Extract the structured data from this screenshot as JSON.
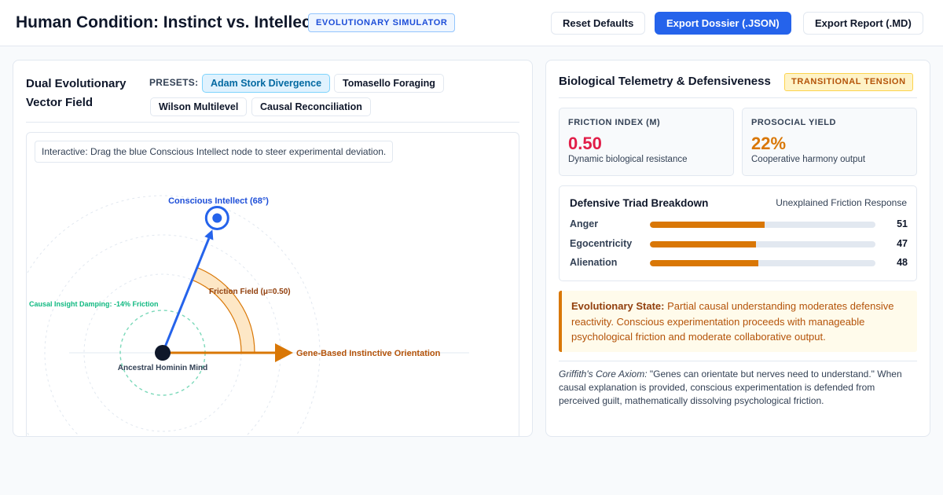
{
  "header": {
    "title": "Human Condition: Instinct vs. Intellect",
    "badge": "EVOLUTIONARY SIMULATOR",
    "buttons": {
      "reset": "Reset Defaults",
      "export_json": "Export Dossier (.JSON)",
      "export_md": "Export Report (.MD)"
    }
  },
  "vector_panel": {
    "title": "Dual Evolutionary Vector Field",
    "presets_label": "PRESETS:",
    "presets": [
      {
        "label": "Adam Stork Divergence",
        "active": true
      },
      {
        "label": "Tomasello Foraging",
        "active": false
      },
      {
        "label": "Wilson Multilevel",
        "active": false
      },
      {
        "label": "Causal Reconciliation",
        "active": false
      }
    ],
    "hint": "Interactive: Drag the blue Conscious Intellect node to steer experimental deviation.",
    "labels": {
      "intellect": "Conscious Intellect (68°)",
      "friction": "Friction Field (μ=0.50)",
      "damping": "Causal Insight Damping: -14% Friction",
      "origin": "Ancestral Hominin Mind",
      "instinct": "Gene-Based Instinctive Orientation"
    },
    "intellect_angle_deg": 68,
    "friction_mu": 0.5,
    "colors": {
      "intellect": "#2563eb",
      "instinct": "#d97706",
      "damping": "#10b981",
      "origin": "#0f172a"
    }
  },
  "telemetry": {
    "title": "Biological Telemetry & Defensiveness",
    "status": "TRANSITIONAL TENSION",
    "metrics": [
      {
        "label": "FRICTION INDEX (M)",
        "value": "0.50",
        "desc": "Dynamic biological resistance",
        "color": "#e11d48"
      },
      {
        "label": "PROSOCIAL YIELD",
        "value": "22%",
        "desc": "Cooperative harmony output",
        "color": "#d97706"
      }
    ],
    "triad": {
      "title": "Defensive Triad Breakdown",
      "subtitle": "Unexplained Friction Response",
      "rows": [
        {
          "label": "Anger",
          "value": 51
        },
        {
          "label": "Egocentricity",
          "value": 47
        },
        {
          "label": "Alienation",
          "value": 48
        }
      ]
    },
    "state": {
      "label": "Evolutionary State:",
      "text": "Partial causal understanding moderates defensive reactivity. Conscious experimentation proceeds with manageable psychological friction and moderate collaborative output."
    },
    "axiom": {
      "label": "Griffith's Core Axiom:",
      "text": "\"Genes can orientate but nerves need to understand.\" When causal explanation is provided, conscious experimentation is defended from perceived guilt, mathematically dissolving psychological friction."
    }
  }
}
